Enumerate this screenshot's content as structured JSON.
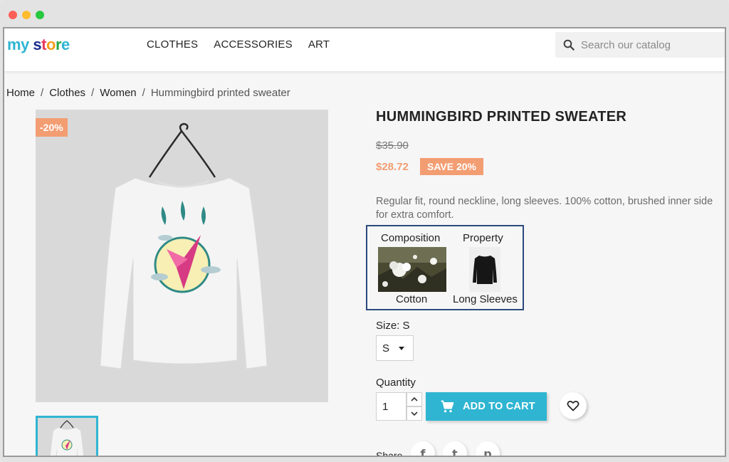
{
  "header": {
    "logo_parts": [
      "my",
      " ",
      "s",
      "t",
      "o",
      "r",
      "e"
    ],
    "nav": [
      "CLOTHES",
      "ACCESSORIES",
      "ART"
    ],
    "search_placeholder": "Search our catalog"
  },
  "breadcrumb": [
    "Home",
    "Clothes",
    "Women",
    "Hummingbird printed sweater"
  ],
  "product": {
    "discount_flag": "-20%",
    "title": "HUMMINGBIRD PRINTED SWEATER",
    "old_price": "$35.90",
    "new_price": "$28.72",
    "save_badge": "SAVE 20%",
    "description": "Regular fit, round neckline, long sleeves. 100% cotton, brushed inner side for extra comfort.",
    "features": {
      "heading_1": "Composition",
      "heading_2": "Property",
      "value_1": "Cotton",
      "value_2": "Long Sleeves"
    },
    "size_label": "Size: S",
    "size_value": "S",
    "quantity_label": "Quantity",
    "quantity_value": "1",
    "add_to_cart": "ADD TO CART",
    "share_label": "Share"
  },
  "colors": {
    "accent": "#2fb5d2",
    "discount": "#f39d72",
    "feature_border": "#2c4a7d"
  },
  "icons": {
    "search": "search-icon",
    "cart": "cart-icon",
    "wishlist": "heart-icon",
    "share": [
      "facebook-icon",
      "twitter-icon",
      "pinterest-icon"
    ]
  }
}
